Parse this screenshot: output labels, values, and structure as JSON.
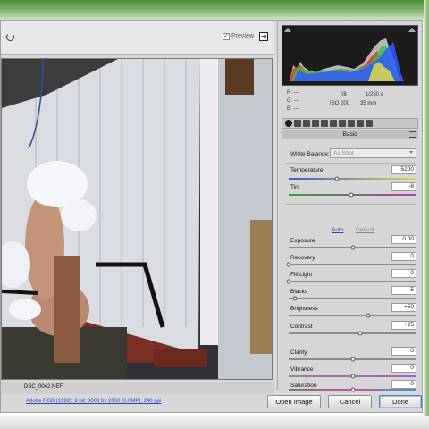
{
  "toolbar": {
    "preview_check": "✓",
    "preview_label": "Preview"
  },
  "photo": {
    "file_name": "DSC_0042.NEF"
  },
  "footer": {
    "workflow_link": "Adobe RGB (1998); 8 bit; 3008 by 2000 (6.0MP); 240 ppi"
  },
  "buttons": {
    "open_image": "Open Image",
    "cancel": "Cancel",
    "done": "Done"
  },
  "camera": {
    "r": "R:  ---",
    "g": "G:  ---",
    "b": "B:  ---",
    "fstop": "f/8",
    "shutter": "1/250 s",
    "iso": "ISO 200",
    "focal": "35 mm"
  },
  "panel": {
    "title": "Basic",
    "white_balance_label": "White Balance:",
    "white_balance_value": "As Shot",
    "auto_label": "Auto",
    "default_label": "Default"
  },
  "sliders": [
    {
      "label": "Temperature",
      "value": "5200",
      "level": 0.38
    },
    {
      "label": "Tint",
      "value": "-8",
      "level": 0.49
    },
    {
      "label": "Exposure",
      "value": "0.00",
      "level": 0.5
    },
    {
      "label": "Recovery",
      "value": "0",
      "level": 0.0
    },
    {
      "label": "Fill Light",
      "value": "0",
      "level": 0.0
    },
    {
      "label": "Blacks",
      "value": "5",
      "level": 0.05
    },
    {
      "label": "Brightness",
      "value": "+50",
      "level": 0.62
    },
    {
      "label": "Contrast",
      "value": "+25",
      "level": 0.56
    },
    {
      "label": "Clarity",
      "value": "0",
      "level": 0.5
    },
    {
      "label": "Vibrance",
      "value": "0",
      "level": 0.5
    },
    {
      "label": "Saturation",
      "value": "0",
      "level": 0.5
    }
  ],
  "colors": {
    "link": "#2a3fc0",
    "done_border": "#4a83c7",
    "frame_green": "#78b060",
    "temperature_gradient": [
      "#3a5cd6",
      "#e0d64a"
    ],
    "tint_gradient": [
      "#34a52f",
      "#b83ab8"
    ],
    "vibrance_gradient": [
      "#8a8a8a",
      "#b05ac8"
    ],
    "saturation_gradient": [
      "#7a7a7a",
      "#d04aa0",
      "#3aa0d8"
    ]
  },
  "icons": [
    "rotate-icon",
    "export-icon",
    "menu-icon",
    "chevron-down-icon"
  ]
}
